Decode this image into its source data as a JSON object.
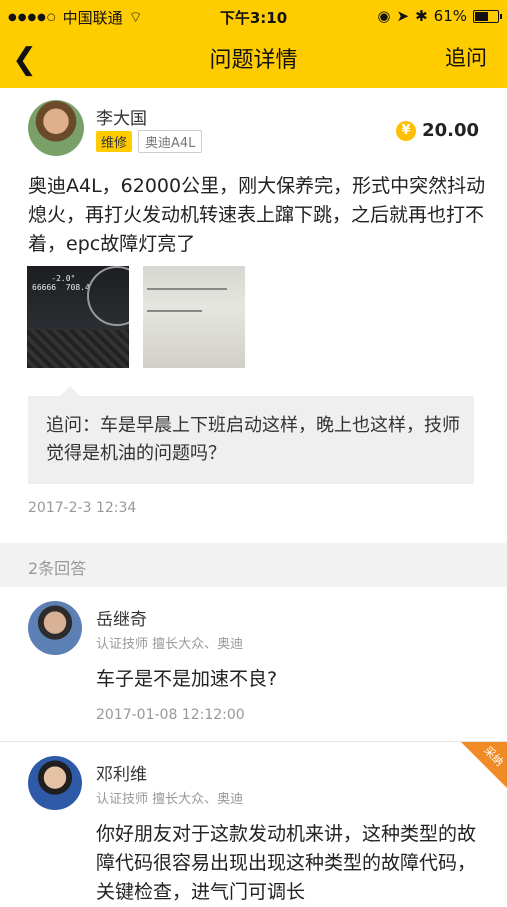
{
  "status_bar": {
    "carrier": "中国联通",
    "time": "下午3:10",
    "battery": "61%",
    "battery_level": 0.61
  },
  "nav": {
    "back_icon": "chevron-left-icon",
    "title": "问题详情",
    "action": "追问"
  },
  "question": {
    "user_name": "李大国",
    "tag_repair": "维修",
    "tag_car": "奥迪A4L",
    "reward_symbol": "¥",
    "reward": "20.00",
    "text": "奥迪A4L，62000公里，刚大保养完，形式中突然抖动熄火，再打火发动机转速表上蹿下跳，之后就再也打不着，epc故障灯亮了",
    "followup": "追问：车是早晨上下班启动这样，晚上也这样，技师觉得是机油的问题吗？",
    "date": "2017-2-3 12:34"
  },
  "answers_header": "2条回答",
  "answers": [
    {
      "name": "岳继奇",
      "meta": "认证技师   擅长大众、奥迪",
      "text": "车子是不是加速不良?",
      "date": "2017-01-08 12:12:00"
    },
    {
      "name": "邓利维",
      "meta": "认证技师   擅长大众、奥迪",
      "text": "你好朋友对于这款发动机来讲，这种类型的故障代码很容易出现出现这种类型的故障代码，关键检查，进气门可调长",
      "badge": "采纳"
    }
  ]
}
